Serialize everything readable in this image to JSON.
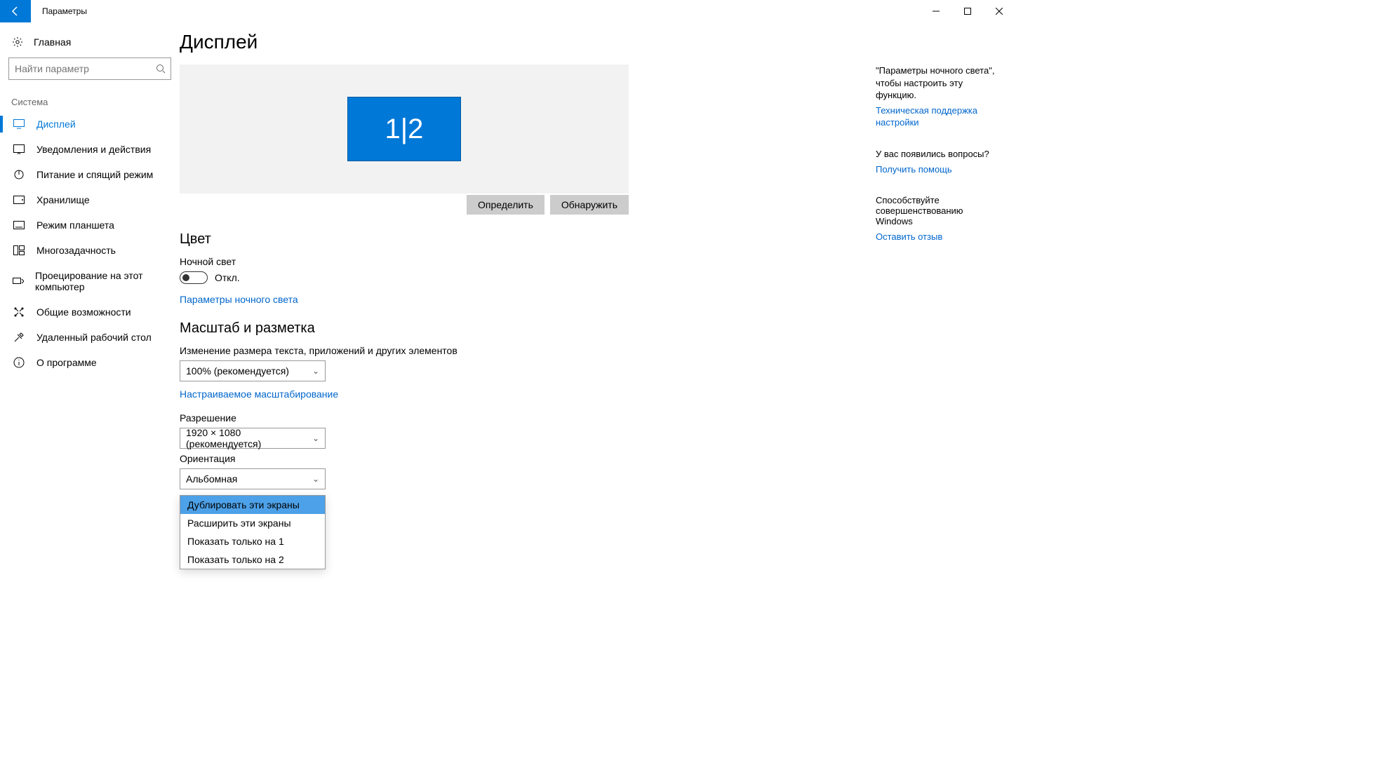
{
  "titlebar": {
    "title": "Параметры"
  },
  "sidebar": {
    "home": "Главная",
    "search_placeholder": "Найти параметр",
    "group": "Система",
    "items": [
      {
        "label": "Дисплей"
      },
      {
        "label": "Уведомления и действия"
      },
      {
        "label": "Питание и спящий режим"
      },
      {
        "label": "Хранилище"
      },
      {
        "label": "Режим планшета"
      },
      {
        "label": "Многозадачность"
      },
      {
        "label": "Проецирование на этот компьютер"
      },
      {
        "label": "Общие возможности"
      },
      {
        "label": "Удаленный рабочий стол"
      },
      {
        "label": "О программе"
      }
    ]
  },
  "page": {
    "title": "Дисплей",
    "monitor_label": "1|2",
    "identify": "Определить",
    "detect": "Обнаружить",
    "color_h": "Цвет",
    "nightlight_label": "Ночной свет",
    "nightlight_state": "Откл.",
    "nightlight_link": "Параметры ночного света",
    "scale_h": "Масштаб и разметка",
    "scale_label": "Изменение размера текста, приложений и других элементов",
    "scale_value": "100% (рекомендуется)",
    "scale_link": "Настраиваемое масштабирование",
    "res_label": "Разрешение",
    "res_value": "1920 × 1080 (рекомендуется)",
    "orient_label": "Ориентация",
    "orient_value": "Альбомная",
    "multi_options": [
      "Дублировать эти экраны",
      "Расширить эти экраны",
      "Показать только на 1",
      "Показать только на 2"
    ]
  },
  "right": {
    "tip1": "\"Параметры ночного света\", чтобы настроить эту функцию.",
    "tip1_link": "Техническая поддержка настройки",
    "q_head": "У вас появились вопросы?",
    "q_link": "Получить помощь",
    "fb_head": "Способствуйте совершенствованию Windows",
    "fb_link": "Оставить отзыв"
  }
}
